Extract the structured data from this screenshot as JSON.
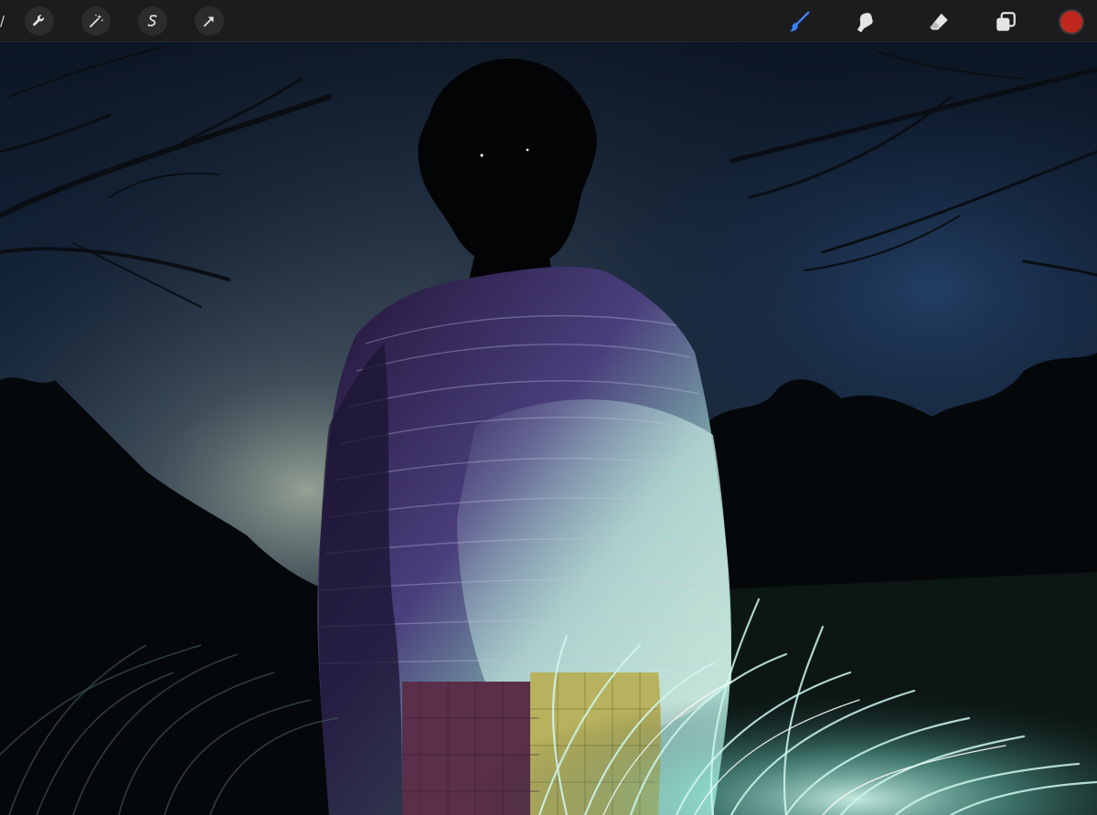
{
  "app": {
    "toolbar": {
      "gallery_stub": "/",
      "left_tools": [
        {
          "name": "actions",
          "icon": "wrench-icon"
        },
        {
          "name": "adjustments",
          "icon": "magic-wand-icon"
        },
        {
          "name": "selection",
          "icon": "selection-s-icon"
        },
        {
          "name": "transform",
          "icon": "arrow-cursor-icon"
        }
      ],
      "right_tools": [
        {
          "name": "brush",
          "icon": "brush-icon",
          "active": true
        },
        {
          "name": "smudge",
          "icon": "smudge-finger-icon"
        },
        {
          "name": "eraser",
          "icon": "eraser-icon"
        },
        {
          "name": "layers",
          "icon": "layers-icon"
        }
      ],
      "current_color": "#c0281e",
      "active_tool_color": "#3b82f6",
      "icon_color": "#e5e5e5"
    },
    "canvas": {
      "subject": "artwork-night-figure-in-grass"
    }
  }
}
